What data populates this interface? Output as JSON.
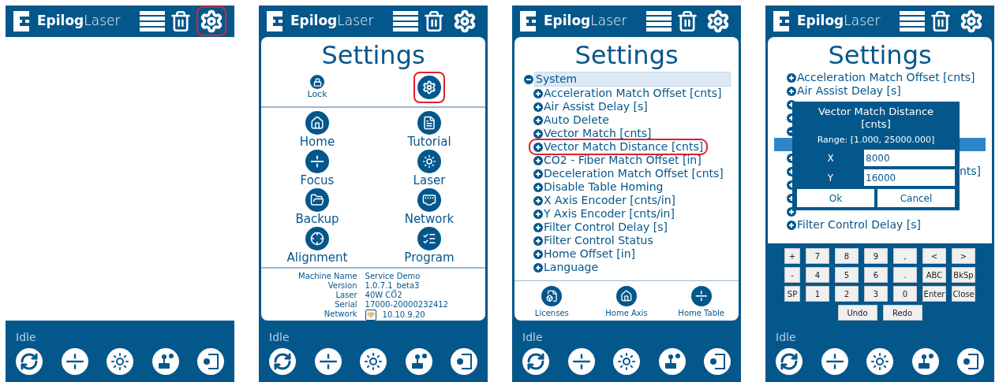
{
  "panels": [
    {
      "kind": "blank",
      "header": {
        "logo_bold": "Epilog",
        "logo_light": "Laser",
        "settings_highlighted": true
      },
      "status": "Idle"
    },
    {
      "kind": "menu",
      "header": {
        "logo_bold": "Epilog",
        "logo_light": "Laser",
        "settings_highlighted": false
      },
      "title": "Settings",
      "lock_label": "Lock",
      "service_highlighted": true,
      "items": [
        {
          "kind": "home",
          "label": "Home"
        },
        {
          "kind": "tutorial",
          "label": "Tutorial"
        },
        {
          "kind": "focus",
          "label": "Focus"
        },
        {
          "kind": "laser",
          "label": "Laser"
        },
        {
          "kind": "backup",
          "label": "Backup"
        },
        {
          "kind": "network",
          "label": "Network"
        },
        {
          "kind": "alignment",
          "label": "Alignment"
        },
        {
          "kind": "program",
          "label": "Program"
        }
      ],
      "info": [
        {
          "label": "Machine Name",
          "value": "Service Demo"
        },
        {
          "label": "Version",
          "value": "1.0.7.1_beta3"
        },
        {
          "label": "Laser",
          "value": "40W CO2"
        },
        {
          "label": "Serial",
          "value": "17000-20000232412"
        },
        {
          "label": "Network",
          "value": "10.10.9.20",
          "wifi": true
        }
      ],
      "status": "Idle"
    },
    {
      "kind": "tree",
      "header": {
        "logo_bold": "Epilog",
        "logo_light": "Laser",
        "settings_highlighted": false
      },
      "title": "Settings",
      "tree": {
        "label": "System",
        "expanded": true,
        "selected": true,
        "children": [
          {
            "label": "Acceleration Match Offset [cnts]",
            "highlighted": false
          },
          {
            "label": "Air Assist Delay [s]",
            "highlighted": false
          },
          {
            "label": "Auto Delete",
            "highlighted": false
          },
          {
            "label": "Vector Match [cnts]",
            "highlighted": false
          },
          {
            "label": "Vector Match Distance [cnts]",
            "highlighted": true
          },
          {
            "label": "CO2 - Fiber Match Offset [in]",
            "highlighted": false
          },
          {
            "label": "Deceleration Match Offset [cnts]",
            "highlighted": false
          },
          {
            "label": "Disable Table Homing",
            "highlighted": false
          },
          {
            "label": "X Axis Encoder [cnts/in]",
            "highlighted": false
          },
          {
            "label": "Y Axis Encoder [cnts/in]",
            "highlighted": false
          },
          {
            "label": "Filter Control Delay [s]",
            "highlighted": false
          },
          {
            "label": "Filter Control Status",
            "highlighted": false
          },
          {
            "label": "Home Offset [in]",
            "highlighted": false
          },
          {
            "label": "Language",
            "highlighted": false
          }
        ]
      },
      "actions": [
        {
          "kind": "licenses",
          "label": "Licenses"
        },
        {
          "kind": "home",
          "label": "Home Axis"
        },
        {
          "kind": "focus",
          "label": "Home Table"
        }
      ],
      "status": "Idle"
    },
    {
      "kind": "dialog",
      "header": {
        "logo_bold": "Epilog",
        "logo_light": "Laser",
        "settings_highlighted": false
      },
      "title": "Settings",
      "rows": [
        {
          "kind": "collapsed",
          "text": "Acceleration Match Offset [cnts]"
        },
        {
          "kind": "collapsed",
          "text": "Air Assist Delay [s]"
        },
        {
          "kind": "collapsed"
        },
        {
          "kind": "collapsed"
        },
        {
          "kind": "expanded"
        },
        {
          "kind": "bar"
        },
        {
          "kind": "collapsed"
        },
        {
          "kind": "tail",
          "text": "nts]"
        },
        {
          "kind": "collapsed"
        },
        {
          "kind": "collapsed"
        },
        {
          "kind": "collapsed"
        },
        {
          "kind": "collapsed",
          "text": "Filter Control Delay [s]"
        }
      ],
      "dialog": {
        "title": "Vector Match Distance [cnts]",
        "range": "Range: [1.000, 25000.000]",
        "fields": [
          {
            "label": "X",
            "value": "8000"
          },
          {
            "label": "Y",
            "value": "16000"
          }
        ],
        "buttons": [
          "Ok",
          "Cancel"
        ]
      },
      "keypad": [
        [
          "+",
          "7",
          "8",
          "9",
          ",",
          "<",
          ">"
        ],
        [
          "-",
          "4",
          "5",
          "6",
          ".",
          "ABC",
          "BkSp"
        ],
        [
          "SP",
          "1",
          "2",
          "3",
          "0",
          "Enter",
          "Close"
        ],
        [
          "Undo",
          "Redo"
        ]
      ],
      "status": "Idle"
    }
  ]
}
